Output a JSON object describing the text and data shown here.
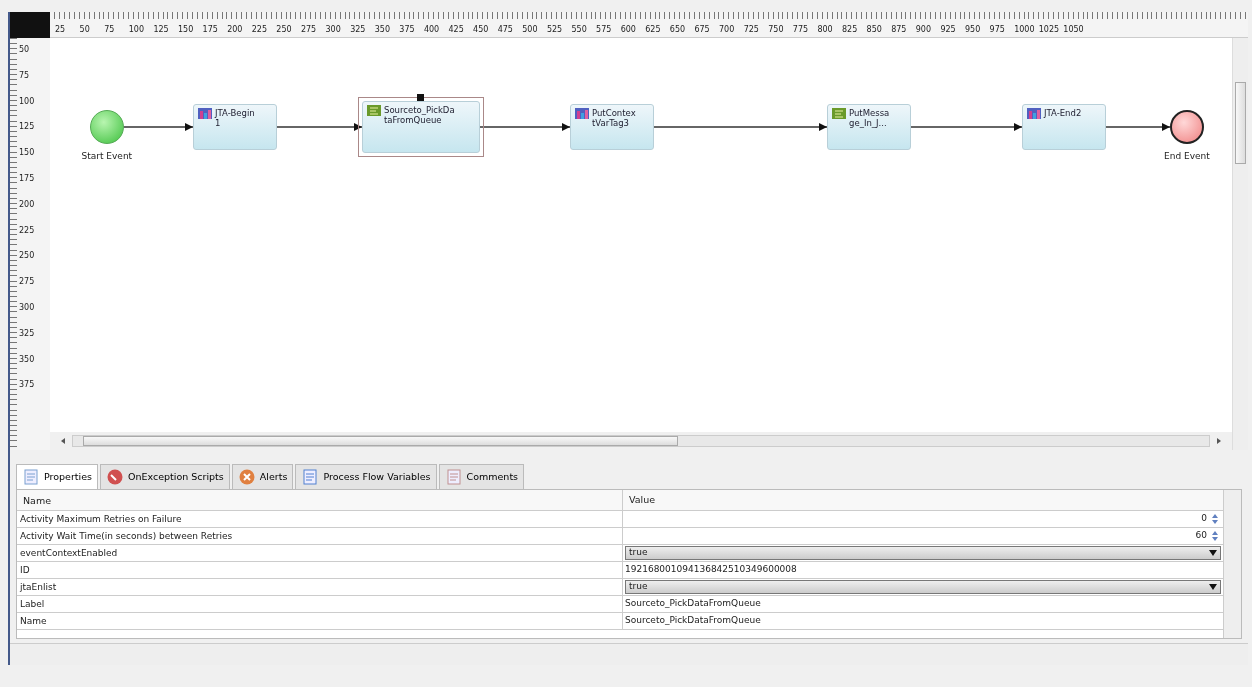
{
  "rulers": {
    "top_labels": [
      "25",
      "50",
      "75",
      "100",
      "125",
      "150",
      "175",
      "200",
      "225",
      "250",
      "275",
      "300",
      "325",
      "350",
      "375",
      "400",
      "425",
      "450",
      "475",
      "500",
      "525",
      "550",
      "575",
      "600",
      "625",
      "650",
      "675",
      "700",
      "725",
      "750",
      "775",
      "800",
      "825",
      "850",
      "875",
      "900",
      "925",
      "950",
      "975",
      "1000",
      "1025",
      "1050"
    ],
    "left_labels": [
      "50",
      "75",
      "100",
      "125",
      "150",
      "175",
      "200",
      "225",
      "250",
      "275",
      "300",
      "325",
      "350",
      "375"
    ]
  },
  "diagram": {
    "nodes": [
      {
        "kind": "start",
        "label": "Start Event",
        "selected": false
      },
      {
        "kind": "jta",
        "label": "JTA-Begin1",
        "selected": false
      },
      {
        "kind": "script",
        "label": "Sourceto_PickDataFromQueue",
        "selected": true
      },
      {
        "kind": "jta",
        "label": "PutContextVarTag3",
        "selected": false
      },
      {
        "kind": "script",
        "label": "PutMessage_In_J...",
        "selected": false
      },
      {
        "kind": "jta",
        "label": "JTA-End2",
        "selected": false
      },
      {
        "kind": "end",
        "label": "End Event",
        "selected": false
      }
    ]
  },
  "tabs": [
    {
      "label": "Properties",
      "kind": "properties",
      "selected": true
    },
    {
      "label": "OnException Scripts",
      "kind": "exception",
      "selected": false
    },
    {
      "label": "Alerts",
      "kind": "alerts",
      "selected": false
    },
    {
      "label": "Process Flow Variables",
      "kind": "variables",
      "selected": false
    },
    {
      "label": "Comments",
      "kind": "comments",
      "selected": false
    }
  ],
  "properties": {
    "columns": [
      "Name",
      "Value"
    ],
    "rows": [
      {
        "name": "Activity Maximum Retries on Failure",
        "kind": "spinner",
        "value": "0"
      },
      {
        "name": "Activity Wait Time(in seconds) between Retries",
        "kind": "spinner",
        "value": "60"
      },
      {
        "name": "eventContextEnabled",
        "kind": "dropdown",
        "value": "true"
      },
      {
        "name": "ID",
        "kind": "text",
        "value": "192168001094136842510349600008"
      },
      {
        "name": "jtaEnlist",
        "kind": "dropdown",
        "value": "true"
      },
      {
        "name": "Label",
        "kind": "text",
        "value": "Sourceto_PickDataFromQueue"
      },
      {
        "name": "Name",
        "kind": "text",
        "value": "Sourceto_PickDataFromQueue"
      }
    ]
  }
}
